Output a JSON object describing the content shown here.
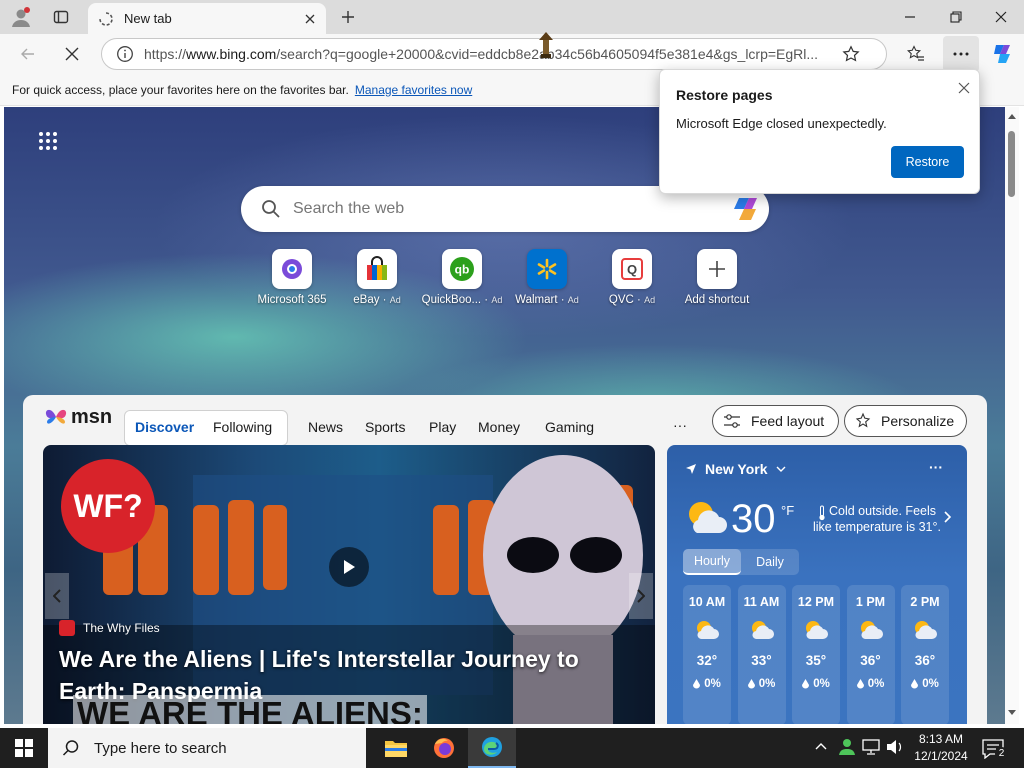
{
  "browser": {
    "tab_title": "New tab",
    "url_prefix": "https://",
    "url_host": "www.bing.com",
    "url_rest": "/search?q=google+20000&cvid=eddcb8e2ab34c56b4605094f5e381e4&gs_lcrp=EgRl..."
  },
  "favorites_bar": {
    "message": "For quick access, place your favorites here on the favorites bar.",
    "link": "Manage favorites now"
  },
  "search": {
    "placeholder": "Search the web"
  },
  "quick_links": [
    {
      "label": "Microsoft 365",
      "ad": ""
    },
    {
      "label": "eBay",
      "ad": "Ad"
    },
    {
      "label": "QuickBoo...",
      "ad": "Ad"
    },
    {
      "label": "Walmart",
      "ad": "Ad"
    },
    {
      "label": "QVC",
      "ad": "Ad"
    },
    {
      "label": "Add shortcut",
      "ad": ""
    }
  ],
  "msn": {
    "logo": "msn",
    "tabs": [
      "Discover",
      "Following"
    ],
    "nav": [
      "News",
      "Sports",
      "Play",
      "Money",
      "Gaming"
    ],
    "more": "···",
    "feed_layout": "Feed layout",
    "personalize": "Personalize"
  },
  "hero": {
    "badge": "WF?",
    "source": "The Why Files",
    "headline": "We Are the Aliens | Life's Interstellar Journey to Earth: Panspermia",
    "overlay_text": "WE ARE THE ALIENS:"
  },
  "weather": {
    "location": "New York",
    "temperature": "30",
    "unit": "°F",
    "summary": "Cold outside. Feels like temperature is 31°.",
    "tabs": [
      "Hourly",
      "Daily"
    ],
    "hours": [
      {
        "time": "10 AM",
        "temp": "32°",
        "precip": "0%"
      },
      {
        "time": "11 AM",
        "temp": "33°",
        "precip": "0%"
      },
      {
        "time": "12 PM",
        "temp": "35°",
        "precip": "0%"
      },
      {
        "time": "1 PM",
        "temp": "36°",
        "precip": "0%"
      },
      {
        "time": "2 PM",
        "temp": "36°",
        "precip": "0%"
      }
    ]
  },
  "restore_dialog": {
    "title": "Restore pages",
    "message": "Microsoft Edge closed unexpectedly.",
    "button": "Restore"
  },
  "taskbar": {
    "search_placeholder": "Type here to search",
    "time": "8:13 AM",
    "date": "12/1/2024",
    "notification_count": "2"
  },
  "colors": {
    "accent": "#0067c0",
    "link": "#0b57b8",
    "weather_bg": "#3a72bf"
  }
}
